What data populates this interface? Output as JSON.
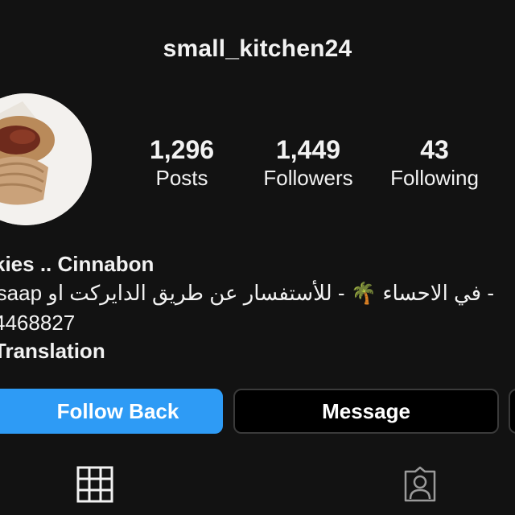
{
  "header": {
    "username": "small_kitchen24"
  },
  "profile": {
    "avatar_icon": "food-photo-avatar",
    "stats": [
      {
        "value": "1,296",
        "label": "Posts"
      },
      {
        "value": "1,449",
        "label": "Followers"
      },
      {
        "value": "43",
        "label": "Following"
      }
    ]
  },
  "bio": {
    "name_line": "kies .. Cinnabon",
    "line2": "- في الاحساء 🌴 - للأستفسار عن طريق الدايركت او saap",
    "line3": "4468827",
    "translation": "Translation"
  },
  "actions": {
    "follow_back_label": "Follow Back",
    "message_label": "Message",
    "follow_color": "#2e9bf5"
  },
  "tabs": {
    "grid_icon": "grid-icon",
    "tagged_icon": "tagged-person-icon"
  }
}
